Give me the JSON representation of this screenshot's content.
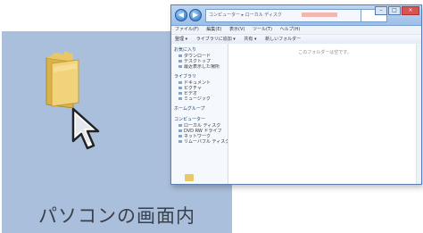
{
  "desktop": {
    "caption": "パソコンの画面内",
    "background_color": "#a9bfdc",
    "folder_icon": "folder-icon",
    "cursor_icon": "mouse-pointer-icon"
  },
  "explorer": {
    "title_bar": {
      "back_icon": "back-arrow-icon",
      "forward_icon": "forward-arrow-icon",
      "address_text": "コンピューター ▸ ローカル ディスク",
      "minimize": "–",
      "maximize": "□",
      "close": "×"
    },
    "menu": [
      "ファイル(F)",
      "編集(E)",
      "表示(V)",
      "ツール(T)",
      "ヘルプ(H)"
    ],
    "toolbar": [
      "整理 ▾",
      "ライブラリに追加 ▾",
      "共有 ▾",
      "新しいフォルダー"
    ],
    "nav_pane": {
      "groups": [
        {
          "head": "お気に入り",
          "items": [
            "ダウンロード",
            "デスクトップ",
            "最近表示した場所"
          ]
        },
        {
          "head": "ライブラリ",
          "items": [
            "ドキュメント",
            "ピクチャ",
            "ビデオ",
            "ミュージック"
          ]
        },
        {
          "head": "ホームグループ",
          "items": []
        },
        {
          "head": "コンピューター",
          "items": [
            "ローカル ディスク",
            "DVD RW ドライブ",
            "ネットワーク",
            "リムーバブル ディスク"
          ]
        }
      ]
    },
    "content": {
      "empty_message": "このフォルダーは空です。"
    }
  },
  "colors": {
    "window_border": "#5a7fb0",
    "title_bar": "#bcd6f3",
    "folder": "#e9c86a"
  }
}
